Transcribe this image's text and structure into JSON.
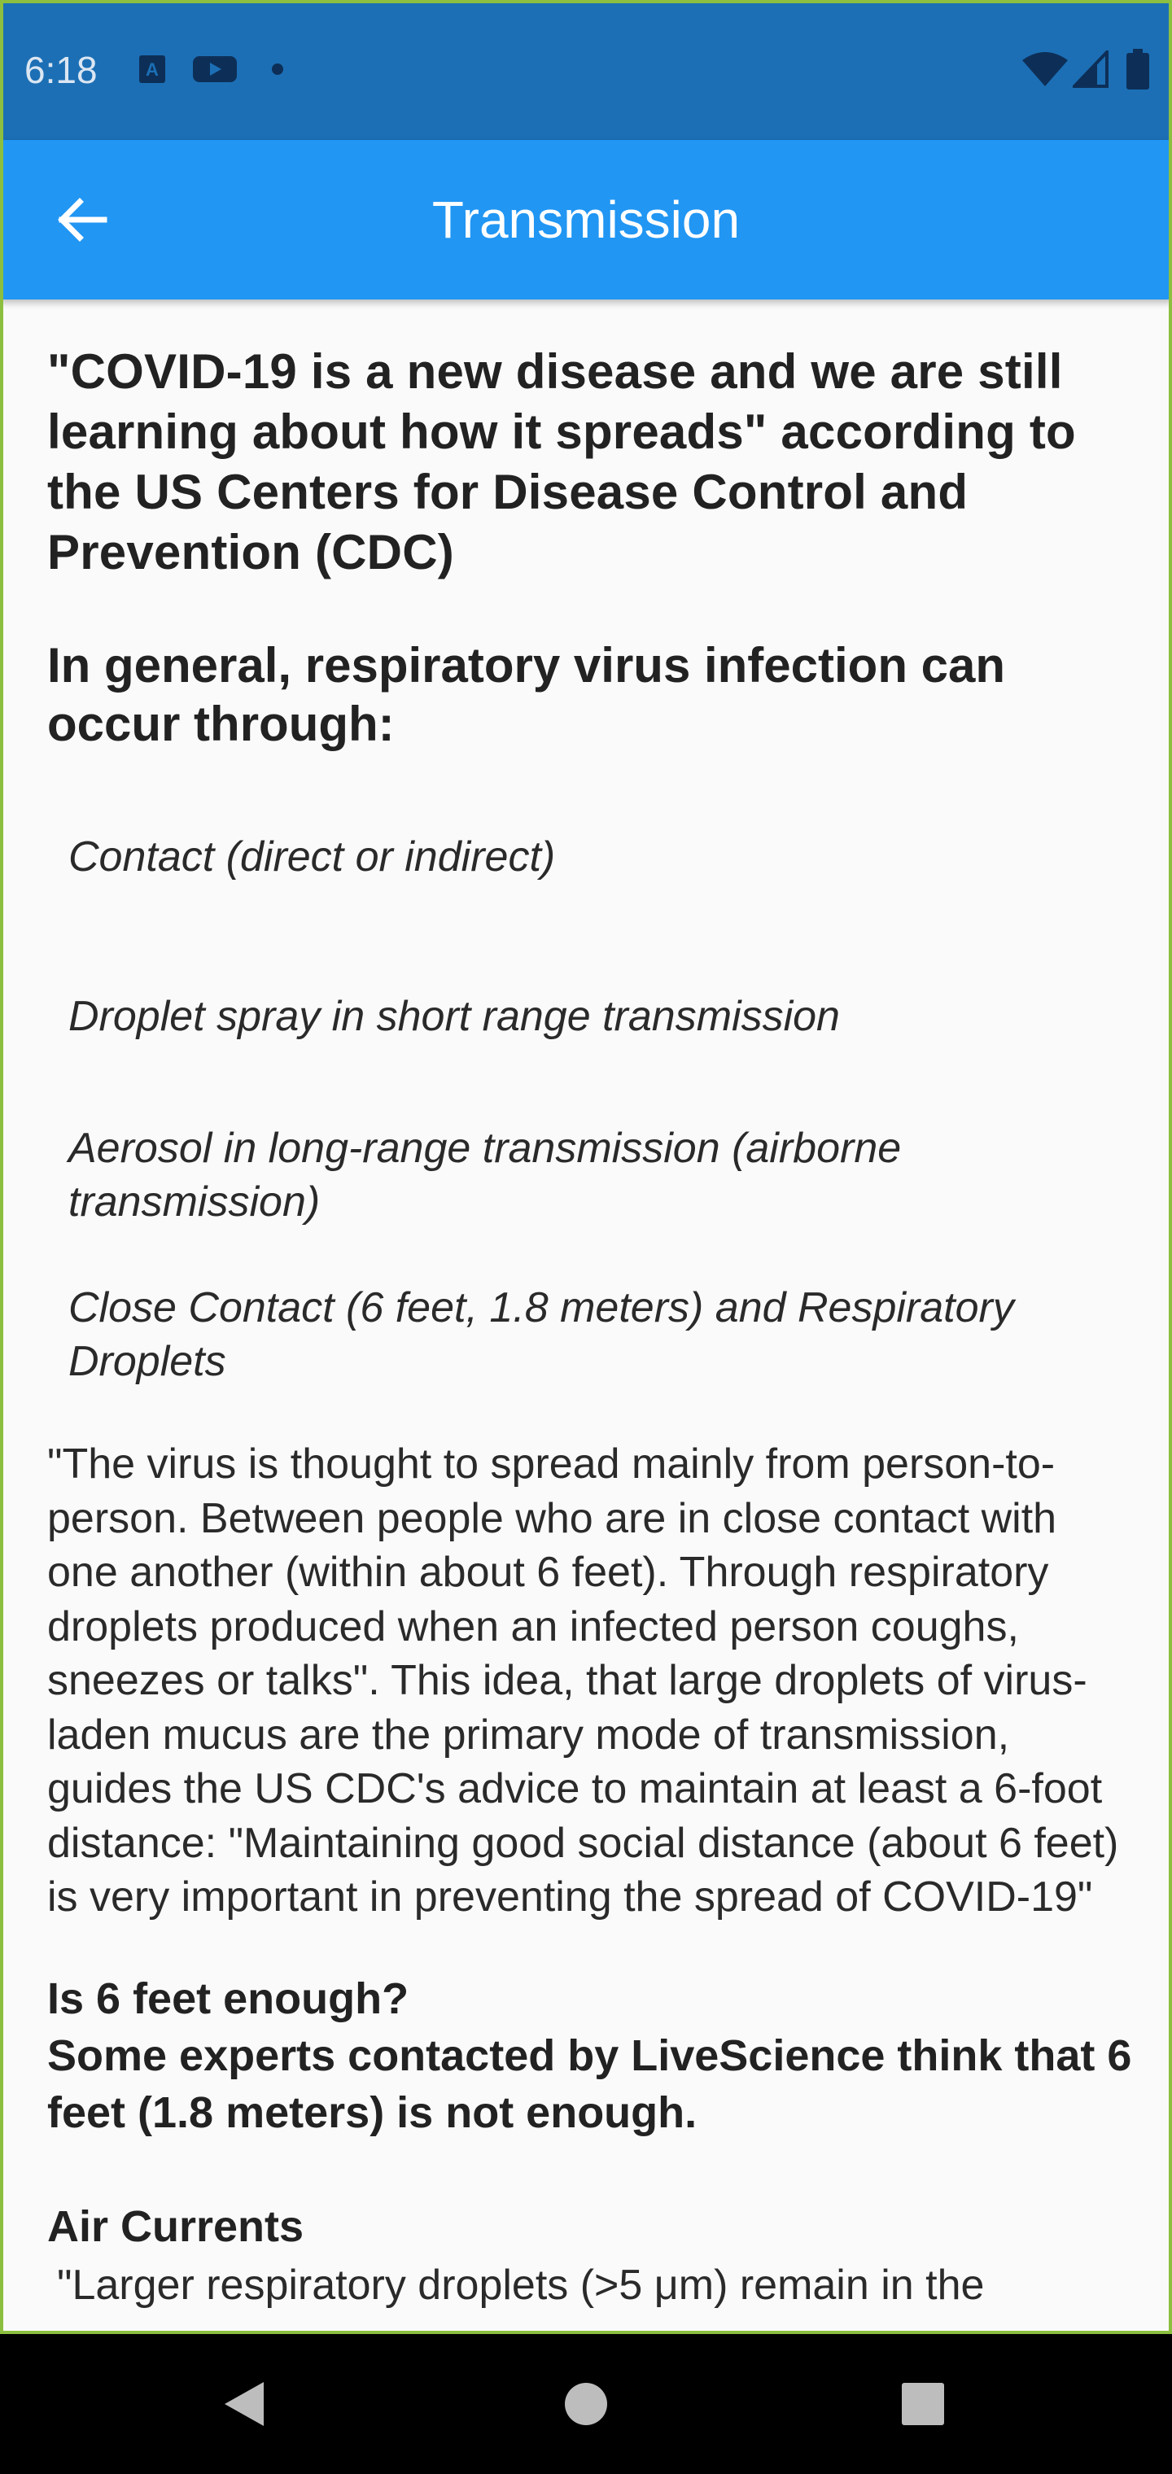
{
  "status_bar": {
    "time": "6:18",
    "icons": [
      "a-icon",
      "youtube-icon",
      "notification-dot-icon",
      "wifi-icon",
      "signal-icon",
      "battery-icon"
    ]
  },
  "app_bar": {
    "title": "Transmission",
    "back_icon": "back-arrow-icon",
    "color": "#2196f3"
  },
  "content": {
    "intro": "\"COVID-19 is a new disease and we are still learning about how it spreads\" according to the US Centers for Disease Control and Prevention (CDC)",
    "subhead": "In general, respiratory virus infection can occur through:",
    "ways": [
      "Contact (direct or indirect)",
      "Droplet spray in short range transmission",
      "Aerosol in long-range transmission (airborne transmission)",
      "Close Contact (6 feet, 1.8 meters) and Respiratory Droplets"
    ],
    "quote": "\"The virus is thought to spread mainly from person-to-person. Between people who are in close contact with one another (within about 6 feet). Through respiratory droplets produced when an infected person coughs, sneezes or talks\". This idea, that large droplets of virus-laden mucus are the primary mode of transmission, guides the US CDC's advice to maintain at least a 6-foot distance: \"Maintaining good social distance (about 6 feet) is very important in preventing the spread of COVID-19\"",
    "question_line1": "Is 6 feet enough?",
    "question_line2": "Some experts contacted by LiveScience think that 6 feet (1.8 meters) is not enough.",
    "air_heading": "Air Currents",
    "air_text": "\"Larger respiratory droplets (>5 μm) remain in the"
  },
  "nav_bar": {
    "buttons": [
      "back-nav-icon",
      "home-nav-icon",
      "recents-nav-icon"
    ]
  }
}
